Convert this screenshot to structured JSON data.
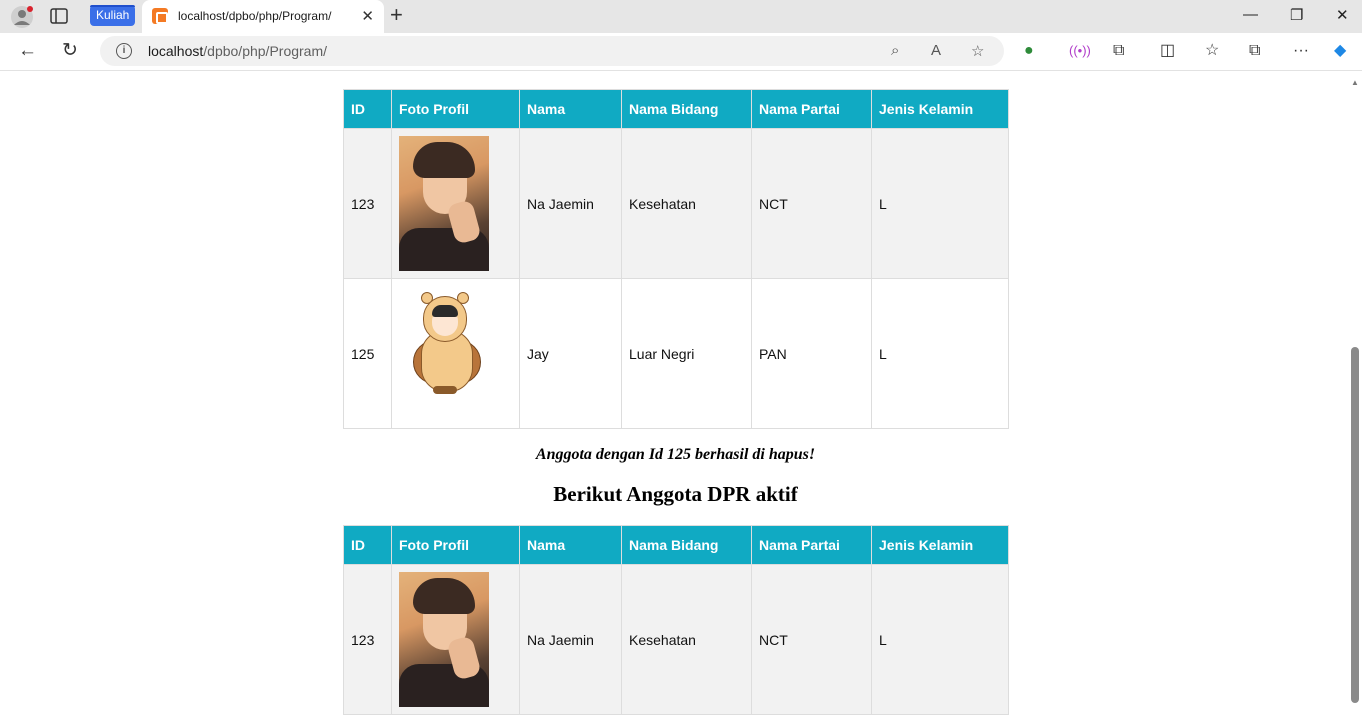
{
  "browser": {
    "tab_group_label": "Kuliah",
    "tab_title": "localhost/dpbo/php/Program/",
    "url_host": "localhost",
    "url_path": "/dpbo/php/Program/"
  },
  "table_headers": [
    "ID",
    "Foto Profil",
    "Nama",
    "Nama Bidang",
    "Nama Partai",
    "Jenis Kelamin"
  ],
  "table1": {
    "rows": [
      {
        "id": "123",
        "photo": "photo-na-jaemin",
        "nama": "Na Jaemin",
        "bidang": "Kesehatan",
        "partai": "NCT",
        "jk": "L"
      },
      {
        "id": "125",
        "photo": "photo-jay-cartoon",
        "nama": "Jay",
        "bidang": "Luar Negri",
        "partai": "PAN",
        "jk": "L"
      }
    ]
  },
  "message": "Anggota dengan Id 125 berhasil di hapus!",
  "heading": "Berikut Anggota DPR aktif",
  "table2": {
    "rows": [
      {
        "id": "123",
        "photo": "photo-na-jaemin",
        "nama": "Na Jaemin",
        "bidang": "Kesehatan",
        "partai": "NCT",
        "jk": "L"
      }
    ]
  },
  "colors": {
    "header_bg": "#10aac3",
    "row_odd": "#f2f2f2",
    "row_even": "#ffffff"
  }
}
